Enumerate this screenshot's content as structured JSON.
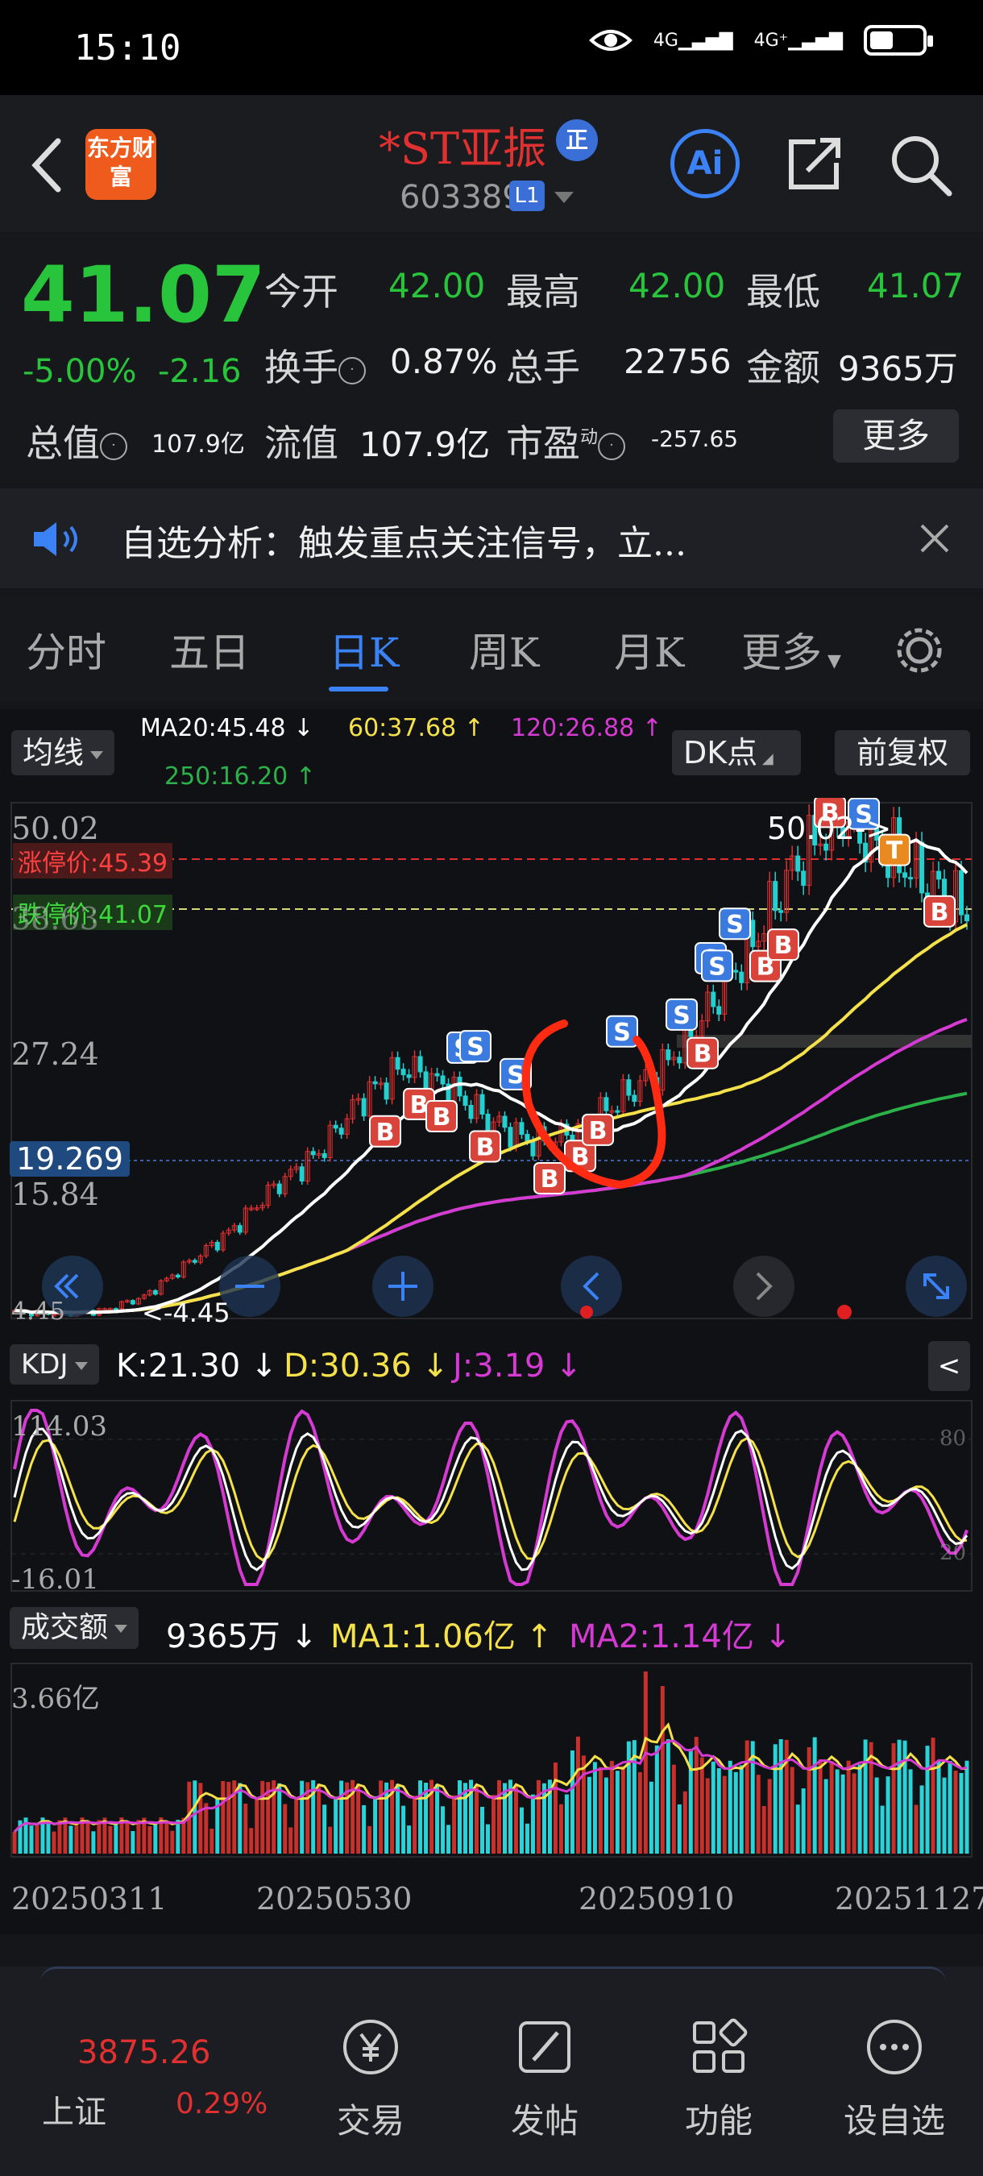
{
  "status": {
    "time": "15:10",
    "net1": "4G",
    "net2": "4G⁺",
    "battery_level": 0.45
  },
  "header": {
    "stock_name": "*ST亚振",
    "badge": "正",
    "code": "603389",
    "level": "L1",
    "logo_text": "东方财富",
    "ai_label": "Ai"
  },
  "quote": {
    "price": "41.07",
    "change_pct": "-5.00%",
    "change": "-2.16",
    "open_label": "今开",
    "open": "42.00",
    "high_label": "最高",
    "high": "42.00",
    "low_label": "最低",
    "low": "41.07",
    "turnover_label": "换手",
    "turnover": "0.87%",
    "hands_label": "总手",
    "hands": "22756",
    "amount_label": "金额",
    "amount": "9365万",
    "mktcap_label": "总值",
    "mktcap": "107.9亿",
    "float_label": "流值",
    "float": "107.9亿",
    "pe_label": "市盈",
    "pe_sup": "动",
    "pe": "-257.65",
    "more": "更多"
  },
  "notice": {
    "text": "自选分析：触发重点关注信号，立..."
  },
  "tabs": [
    "分时",
    "五日",
    "日K",
    "周K",
    "月K",
    "更多"
  ],
  "ma": {
    "selector": "均线",
    "ma20": "MA20:45.48 ↓",
    "ma60": "60:37.68 ↑",
    "ma120": "120:26.88 ↑",
    "ma250": "250:16.20 ↑",
    "dk": "DK点",
    "adjust": "前复权"
  },
  "price_chart": {
    "y_labels": [
      "50.02",
      "38.63",
      "27.24",
      "15.84",
      "4.45"
    ],
    "limit_up": "涨停价:45.39",
    "limit_down": "跌停价:41.07",
    "cursor_price": "19.269",
    "high_mark": "50.02->",
    "low_mark": "<-4.45"
  },
  "kdj": {
    "selector": "KDJ",
    "k": "K:21.30 ↓",
    "d": "D:30.36 ↓",
    "j": "J:3.19 ↓",
    "top": "114.03",
    "bottom": "-16.01",
    "right_top": "80",
    "right_bottom": "20"
  },
  "volume": {
    "selector": "成交额",
    "value": "9365万 ↓",
    "ma1": "MA1:1.06亿 ↑",
    "ma2": "MA2:1.14亿 ↓",
    "top": "3.66亿"
  },
  "dates": [
    "20250311",
    "20250530",
    "20250910",
    "20251127"
  ],
  "bottom": {
    "index_value": "3875.26",
    "index_name": "上证",
    "index_chg": "0.29%",
    "items": [
      "交易",
      "发帖",
      "功能",
      "设自选"
    ]
  },
  "colors": {
    "green": "#28c43c",
    "red": "#e03030",
    "blue": "#3b82f6",
    "ma20": "#ffffff",
    "ma60": "#f5e14a",
    "ma120": "#d53ad3",
    "ma250": "#2bb04a"
  },
  "chart_data": {
    "type": "candlestick",
    "x_range": [
      "20250311",
      "20251127"
    ],
    "y_range": [
      4.45,
      50.02
    ],
    "close_approx": [
      4.6,
      4.5,
      4.7,
      6,
      9,
      12,
      16,
      19,
      24,
      27,
      25,
      22,
      20,
      21,
      24,
      27,
      32,
      38,
      45,
      50,
      47,
      44,
      41.07
    ]
  }
}
